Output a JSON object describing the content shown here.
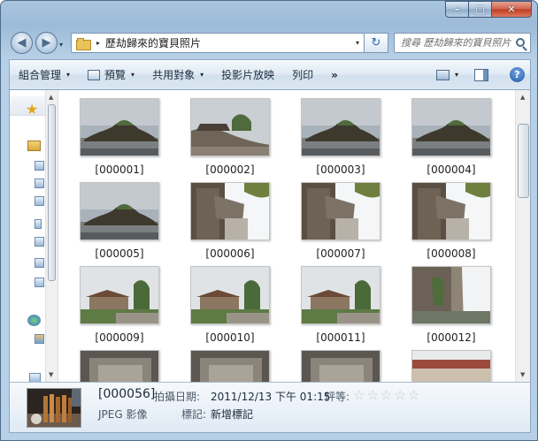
{
  "window": {
    "caption": {
      "minimize": "–",
      "maximize": "□",
      "close": "✕"
    }
  },
  "address_bar": {
    "path": "歷劫歸來的寶貝照片",
    "arrow": "▸",
    "dropdown": "▾",
    "refresh": "↻"
  },
  "search": {
    "placeholder": "搜尋 歷劫歸來的寶貝照片"
  },
  "nav": {
    "back": "◀",
    "forward": "▶",
    "history_drop": "▾"
  },
  "toolbar": {
    "organize": "組合管理",
    "preview": "預覽",
    "share": "共用對象",
    "slideshow": "投影片放映",
    "print": "列印",
    "more": "»",
    "caret": "▾",
    "help": "?"
  },
  "nav_pane": {
    "star": "★",
    "scroll_up": "▲",
    "scroll_down": "▼"
  },
  "scrollbar": {
    "up": "▲",
    "down": "▼"
  },
  "photos": [
    {
      "label": "[000001]",
      "scene": "temple-rock"
    },
    {
      "label": "[000002]",
      "scene": "cliff-temple"
    },
    {
      "label": "[000003]",
      "scene": "temple-rock"
    },
    {
      "label": "[000004]",
      "scene": "temple-rock"
    },
    {
      "label": "[000005]",
      "scene": "temple-rock"
    },
    {
      "label": "[000006]",
      "scene": "gate"
    },
    {
      "label": "[000007]",
      "scene": "gate"
    },
    {
      "label": "[000008]",
      "scene": "gate"
    },
    {
      "label": "[000009]",
      "scene": "courtyard"
    },
    {
      "label": "[000010]",
      "scene": "courtyard"
    },
    {
      "label": "[000011]",
      "scene": "courtyard"
    },
    {
      "label": "[000012]",
      "scene": "wall"
    },
    {
      "label": "",
      "scene": "interior"
    },
    {
      "label": "",
      "scene": "interior"
    },
    {
      "label": "",
      "scene": "interior"
    },
    {
      "label": "",
      "scene": "roof"
    }
  ],
  "details": {
    "name": "[000056]",
    "date_label": "拍攝日期:",
    "date_value": "2011/12/13 下午 01:15",
    "rating_label": "評等:",
    "rating": 0,
    "rating_max": 5,
    "type": "JPEG 影像",
    "tags_label": "標記:",
    "tags_value": "新增標記"
  }
}
